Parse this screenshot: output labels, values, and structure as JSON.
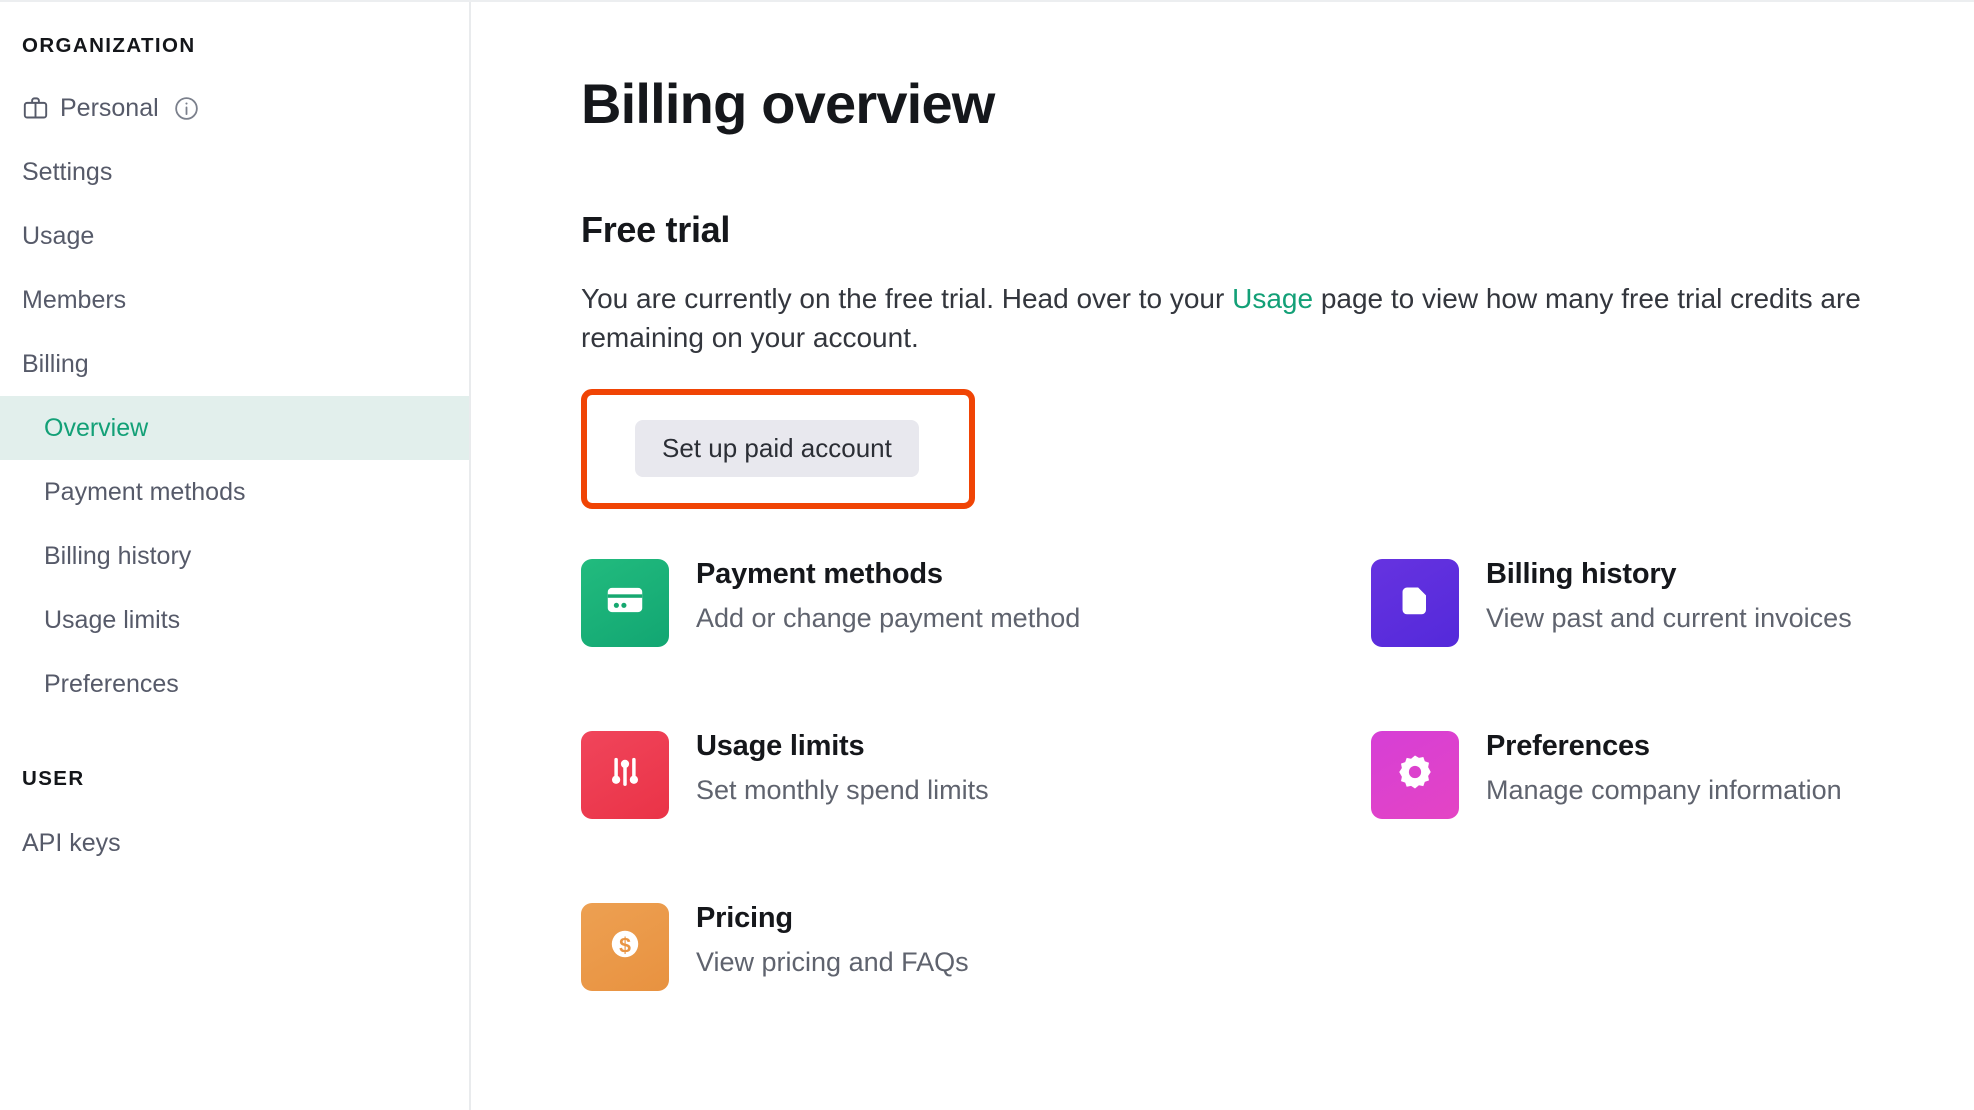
{
  "sidebar": {
    "sections": [
      {
        "title": "ORGANIZATION",
        "items": [
          {
            "label": "Personal",
            "icon": "briefcase-icon",
            "trailing_icon": "info-circle-icon",
            "level": "top",
            "active": false
          },
          {
            "label": "Settings",
            "level": "top",
            "active": false
          },
          {
            "label": "Usage",
            "level": "top",
            "active": false
          },
          {
            "label": "Members",
            "level": "top",
            "active": false
          },
          {
            "label": "Billing",
            "level": "top",
            "active": false
          },
          {
            "label": "Overview",
            "level": "sub",
            "active": true
          },
          {
            "label": "Payment methods",
            "level": "sub",
            "active": false
          },
          {
            "label": "Billing history",
            "level": "sub",
            "active": false
          },
          {
            "label": "Usage limits",
            "level": "sub",
            "active": false
          },
          {
            "label": "Preferences",
            "level": "sub",
            "active": false
          }
        ]
      },
      {
        "title": "USER",
        "items": [
          {
            "label": "API keys",
            "level": "top",
            "active": false
          }
        ]
      }
    ]
  },
  "main": {
    "page_title": "Billing overview",
    "section_title": "Free trial",
    "lede": {
      "before_link": "You are currently on the free trial. Head over to your ",
      "link_text": "Usage",
      "after_link": " page to view how many free trial credits are remaining on your account."
    },
    "cta": {
      "label": "Set up paid account",
      "annotated": true,
      "annotation_color": "#f04405"
    },
    "cards": [
      {
        "title": "Payment methods",
        "subtitle": "Add or change payment method",
        "icon": "credit-card-icon",
        "tile_color": "#16a870",
        "tile_class": "tile-green"
      },
      {
        "title": "Billing history",
        "subtitle": "View past and current invoices",
        "icon": "document-icon",
        "tile_color": "#5a2edc",
        "tile_class": "tile-purple"
      },
      {
        "title": "Usage limits",
        "subtitle": "Set monthly spend limits",
        "icon": "sliders-icon",
        "tile_color": "#ec3a4e",
        "tile_class": "tile-red"
      },
      {
        "title": "Preferences",
        "subtitle": "Manage company information",
        "icon": "gear-icon",
        "tile_color": "#dc41cd",
        "tile_class": "tile-pink"
      },
      {
        "title": "Pricing",
        "subtitle": "View pricing and FAQs",
        "icon": "dollar-coin-icon",
        "tile_color": "#e99544",
        "tile_class": "tile-orange"
      }
    ]
  },
  "colors": {
    "accent_green": "#13a077",
    "active_row_bg": "#e2efec",
    "annotation_red": "#f04405",
    "button_bg": "#e8e8ee"
  }
}
